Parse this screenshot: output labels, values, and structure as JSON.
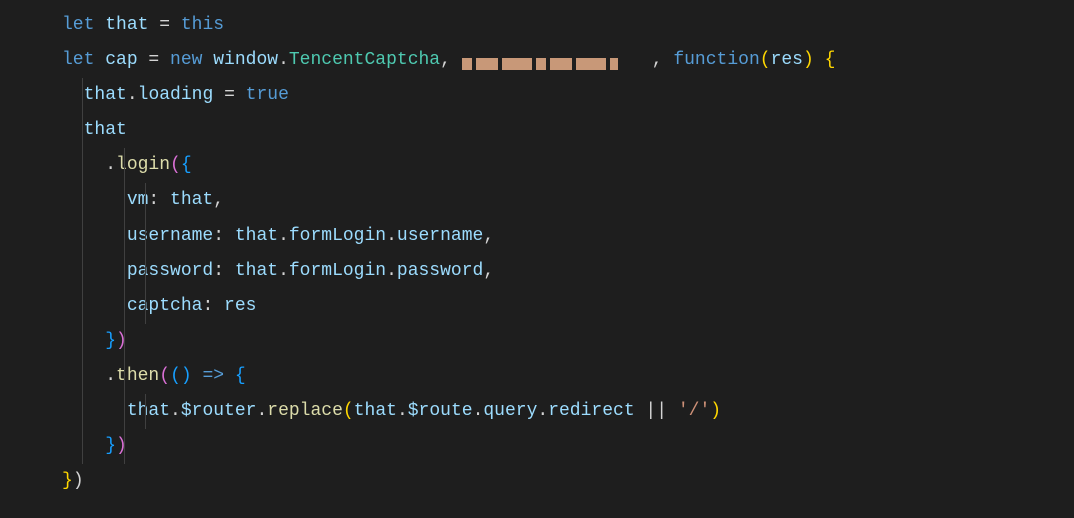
{
  "code": {
    "l1": {
      "let": "let",
      "that": "that",
      "eq": " = ",
      "this": "this"
    },
    "l2": {
      "let": "let",
      "cap": "cap",
      "eq": " = ",
      "new": "new",
      "window": "window",
      "dot": ".",
      "TencentCaptcha": "TencentCaptcha",
      "comma1": ", ",
      "comma2": ", ",
      "function": "function",
      "lp": "(",
      "res": "res",
      "rp": ")",
      "lb": " {"
    },
    "l3": {
      "that": "that",
      "dot": ".",
      "loading": "loading",
      "eq": " = ",
      "true": "true"
    },
    "l4": {
      "that": "that"
    },
    "l5": {
      "dot": ".",
      "login": "login",
      "lp": "(",
      "lb": "{"
    },
    "l6": {
      "vm": "vm",
      "colon": ": ",
      "that": "that",
      "comma": ","
    },
    "l7": {
      "username": "username",
      "colon": ": ",
      "that": "that",
      "d1": ".",
      "formLogin": "formLogin",
      "d2": ".",
      "username2": "username",
      "comma": ","
    },
    "l8": {
      "password": "password",
      "colon": ": ",
      "that": "that",
      "d1": ".",
      "formLogin": "formLogin",
      "d2": ".",
      "password2": "password",
      "comma": ","
    },
    "l9": {
      "captcha": "captcha",
      "colon": ": ",
      "res": "res"
    },
    "l10": {
      "rb": "}",
      "rp": ")"
    },
    "l11": {
      "dot": ".",
      "then": "then",
      "lp": "(",
      "lp2": "(",
      "rp2": ")",
      "arrow": " => ",
      "lb": "{"
    },
    "l12": {
      "that": "that",
      "d1": ".",
      "router": "$router",
      "d2": ".",
      "replace": "replace",
      "lp": "(",
      "that2": "that",
      "d3": ".",
      "route": "$route",
      "d4": ".",
      "query": "query",
      "d5": ".",
      "redirect": "redirect",
      "or": " || ",
      "str": "'/'",
      "rp": ")"
    },
    "l13": {
      "rb": "}",
      "rp": ")"
    },
    "l14": {
      "rb": "}",
      "rp": ")"
    }
  }
}
